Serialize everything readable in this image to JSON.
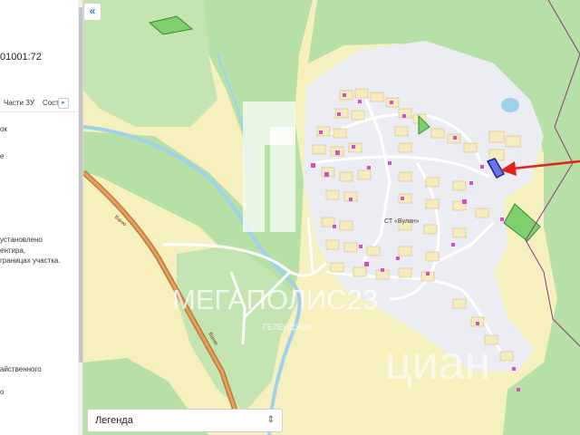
{
  "left_panel": {
    "cadastral_number": "01001:72",
    "tabs": [
      "Части ЗУ",
      "Соста"
    ],
    "tab_next_icon": "chevron-right-icon",
    "text_lines": [
      "ок",
      "е",
      "установлено",
      "ентира,",
      "границах участка.",
      "айственного",
      "о"
    ]
  },
  "map": {
    "collapse_icon": "double-chevron-left-icon",
    "settlement_label": "СТ «Вулан»",
    "road_labels": [
      "Ваню",
      "Ваню"
    ],
    "watermark": {
      "title": "МЕГАПОЛИС23",
      "subtitle": "ГЕЛЕНДЖИК",
      "brand": "циан"
    },
    "legend_label": "Легенда",
    "colors": {
      "forest": "#b7e0a6",
      "field": "#f6efbe",
      "river": "#9fd1ec",
      "highlight_parcel": "#2f3db8",
      "arrow": "#e0231b",
      "purple_boundary": "#8a3a78"
    }
  }
}
